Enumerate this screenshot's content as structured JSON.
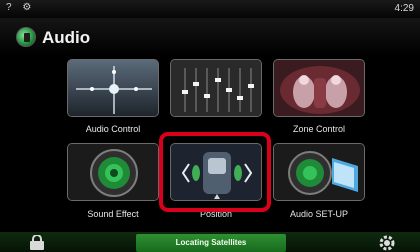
{
  "status": {
    "icons": "? ⚙",
    "time": "4:29"
  },
  "header": {
    "title": "Audio"
  },
  "tiles": [
    {
      "label": "Audio Control",
      "icon": "crossover-joystick-icon"
    },
    {
      "label": "",
      "icon": "equalizer-icon"
    },
    {
      "label": "Zone Control",
      "icon": "car-interior-icon"
    },
    {
      "label": "Sound Effect",
      "icon": "speaker-icon"
    },
    {
      "label": "Position",
      "icon": "listening-position-icon"
    },
    {
      "label": "Audio SET-UP",
      "icon": "speaker-setup-icon"
    }
  ],
  "footer": {
    "notice": "Locating Satellites"
  },
  "colors": {
    "highlight": "#d8001a",
    "notice_bg": "#2f8f32"
  }
}
